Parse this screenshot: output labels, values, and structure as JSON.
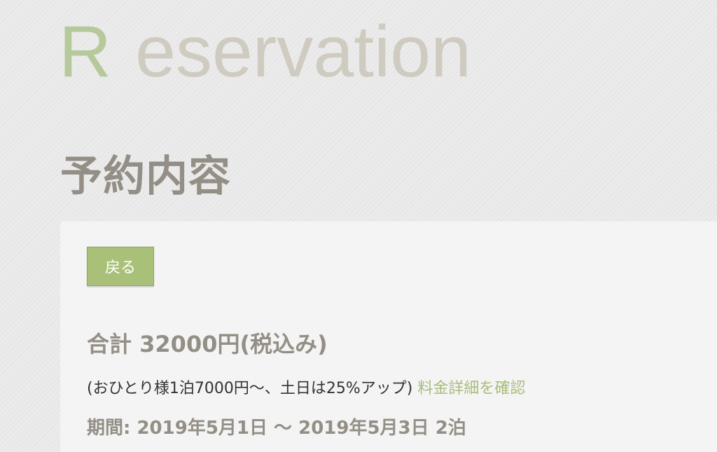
{
  "brand": {
    "initial": "R",
    "rest": "eservation"
  },
  "page": {
    "title": "予約内容"
  },
  "panel": {
    "back_label": "戻る",
    "total_label": "合計 32000円(税込み)",
    "note": "(おひとり様1泊7000円〜、土日は25%アップ)",
    "detail_link": "料金詳細を確認",
    "period": "期間: 2019年5月1日 〜 2019年5月3日 2泊"
  },
  "colors": {
    "accent_green": "#a9c079",
    "heading_gray": "#948f86",
    "logo_r": "#b6c99a",
    "logo_rest": "#cfcbc1"
  }
}
